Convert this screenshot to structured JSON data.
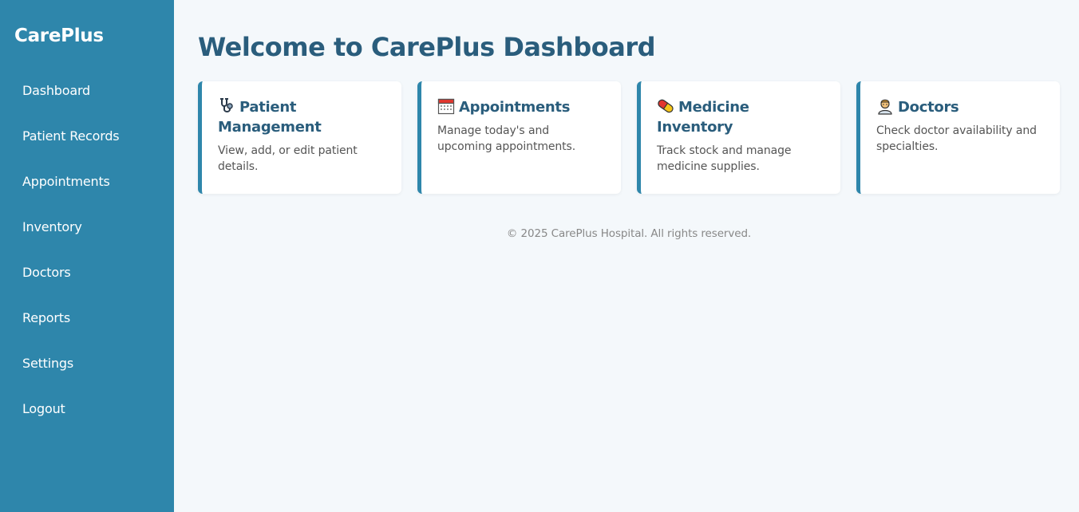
{
  "sidebar": {
    "brand": "CarePlus",
    "items": [
      {
        "label": "Dashboard"
      },
      {
        "label": "Patient Records"
      },
      {
        "label": "Appointments"
      },
      {
        "label": "Inventory"
      },
      {
        "label": "Doctors"
      },
      {
        "label": "Reports"
      },
      {
        "label": "Settings"
      },
      {
        "label": "Logout"
      }
    ]
  },
  "main": {
    "title": "Welcome to CarePlus Dashboard",
    "cards": [
      {
        "icon": "stethoscope-icon",
        "title": "Patient Management",
        "description": "View, add, or edit patient details."
      },
      {
        "icon": "calendar-icon",
        "title": "Appointments",
        "description": "Manage today's and upcoming appointments."
      },
      {
        "icon": "pill-icon",
        "title": "Medicine Inventory",
        "description": "Track stock and manage medicine supplies."
      },
      {
        "icon": "doctor-icon",
        "title": "Doctors",
        "description": "Check doctor availability and specialties."
      }
    ],
    "footer": "© 2025 CarePlus Hospital. All rights reserved."
  },
  "colors": {
    "sidebar_bg": "#2e86ab",
    "heading": "#2a5d7c",
    "page_bg": "#f4f8fb",
    "card_accent": "#2e86ab"
  }
}
